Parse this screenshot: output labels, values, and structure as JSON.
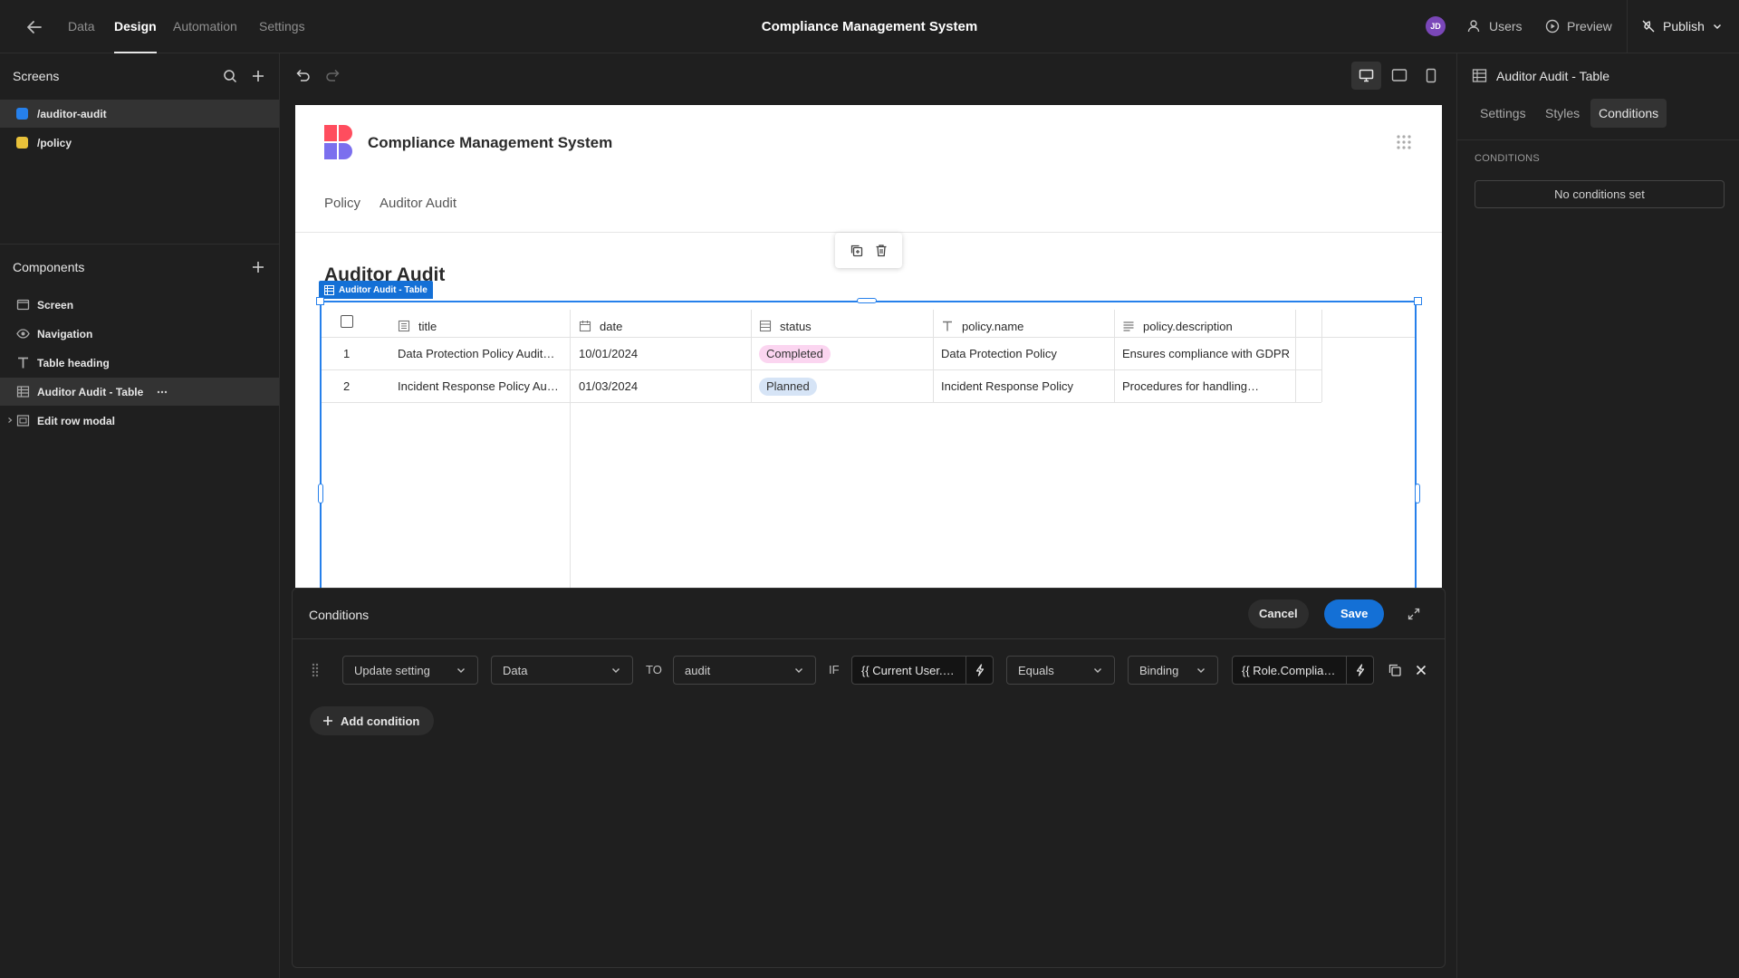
{
  "topbar": {
    "tabs": [
      "Data",
      "Design",
      "Automation",
      "Settings"
    ],
    "app_title": "Compliance Management System",
    "avatar_initials": "JD",
    "users_label": "Users",
    "preview_label": "Preview",
    "publish_label": "Publish"
  },
  "screens_panel": {
    "title": "Screens",
    "items": [
      {
        "label": "/auditor-audit",
        "color": "#2680eb"
      },
      {
        "label": "/policy",
        "color": "#e8c13a"
      }
    ]
  },
  "components_panel": {
    "title": "Components",
    "items": [
      {
        "label": "Screen",
        "icon": "screen-icon"
      },
      {
        "label": "Navigation",
        "icon": "eye-icon"
      },
      {
        "label": "Table heading",
        "icon": "text-icon"
      },
      {
        "label": "Auditor Audit - Table",
        "icon": "table-icon"
      },
      {
        "label": "Edit row modal",
        "icon": "modal-icon"
      }
    ]
  },
  "preview": {
    "app_name": "Compliance Management System",
    "nav_links": [
      "Policy",
      "Auditor Audit"
    ],
    "page_heading": "Auditor Audit",
    "component_tag": "Auditor Audit - Table",
    "table": {
      "columns": [
        "title",
        "date",
        "status",
        "policy.name",
        "policy.description"
      ],
      "rows": [
        {
          "num": "1",
          "title": "Data Protection Policy Audit…",
          "date": "10/01/2024",
          "status": "Completed",
          "policy_name": "Data Protection Policy",
          "policy_description": "Ensures compliance with GDPR"
        },
        {
          "num": "2",
          "title": "Incident Response Policy Au…",
          "date": "01/03/2024",
          "status": "Planned",
          "policy_name": "Incident Response Policy",
          "policy_description": "Procedures for handling…"
        }
      ],
      "status_colors": {
        "Completed": "#fbd5f0",
        "Planned": "#d6e4f6"
      }
    }
  },
  "conditions_drawer": {
    "title": "Conditions",
    "cancel_label": "Cancel",
    "save_label": "Save",
    "row": {
      "action": "Update setting",
      "setting": "Data",
      "to_label": "TO",
      "value": "audit",
      "if_label": "IF",
      "left_binding": "{{ Current User.…",
      "operator": "Equals",
      "type": "Binding",
      "right_binding": "{{ Role.Complia…"
    },
    "add_condition_label": "Add condition"
  },
  "right_panel": {
    "component_title": "Auditor Audit - Table",
    "tabs": [
      "Settings",
      "Styles",
      "Conditions"
    ],
    "section_title": "CONDITIONS",
    "empty_state": "No conditions set"
  },
  "colors": {
    "accent": "#1470d6",
    "selection": "#2680eb"
  }
}
